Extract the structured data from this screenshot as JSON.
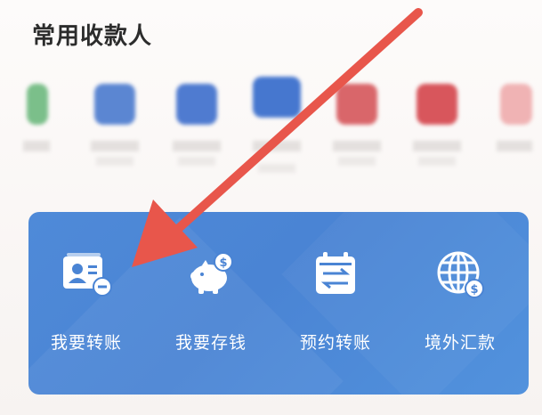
{
  "section": {
    "title": "常用收款人"
  },
  "payees": [
    {
      "color": "#7bbf8a"
    },
    {
      "color": "#5b86d2"
    },
    {
      "color": "#4f7bd0"
    },
    {
      "color": "#4677cf"
    },
    {
      "color": "#d9666a"
    },
    {
      "color": "#d8565c"
    },
    {
      "color": "#f0b3b4"
    }
  ],
  "services": [
    {
      "label": "我要转账",
      "icon": "transfer-card-icon"
    },
    {
      "label": "我要存钱",
      "icon": "piggy-bank-icon"
    },
    {
      "label": "预约转账",
      "icon": "scheduled-transfer-icon"
    },
    {
      "label": "境外汇款",
      "icon": "globe-remittance-icon"
    }
  ],
  "colors": {
    "card": "#4a84d4",
    "arrow": "#e8564b",
    "text_title": "#2c2c2c"
  }
}
